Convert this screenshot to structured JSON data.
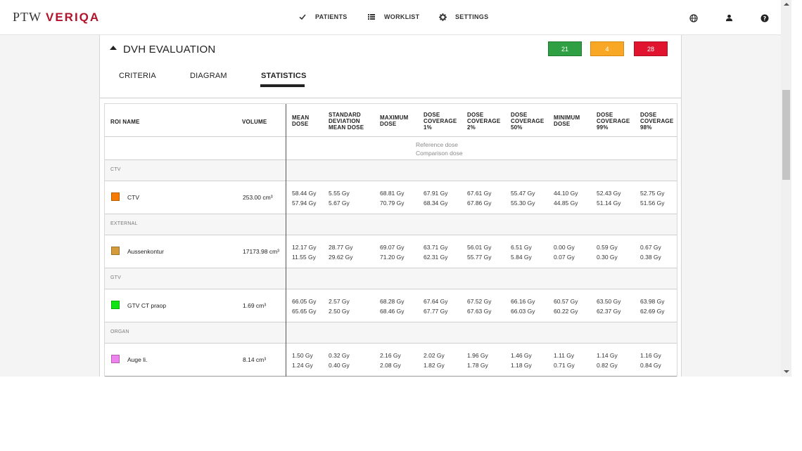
{
  "app": {
    "logo_left": "PTW",
    "logo_right": "VERIQA"
  },
  "nav": {
    "patients": "PATIENTS",
    "worklist": "WORKLIST",
    "settings": "SETTINGS"
  },
  "icons": {
    "patients": "check-icon",
    "worklist": "list-icon",
    "settings": "gear-icon",
    "right": [
      "globe-icon",
      "user-icon",
      "help-icon"
    ]
  },
  "panel": {
    "title": "DVH EVALUATION",
    "badges": {
      "green": "21",
      "orange": "4",
      "red": "28"
    },
    "colors": {
      "green": "#2ea043",
      "orange": "#f9a825",
      "red": "#e0142e"
    },
    "tabs": [
      "CRITERIA",
      "DIAGRAM",
      "STATISTICS"
    ],
    "active_tab": "STATISTICS"
  },
  "table": {
    "headers": {
      "roi_name": "ROI NAME",
      "volume": "VOLUME",
      "cols": [
        [
          "MEAN",
          "DOSE"
        ],
        [
          "STANDARD",
          "DEVIATION",
          "MEAN DOSE"
        ],
        [
          "MAXIMUM",
          "DOSE"
        ],
        [
          "DOSE",
          "COVERAGE",
          "1%"
        ],
        [
          "DOSE",
          "COVERAGE",
          "2%"
        ],
        [
          "DOSE",
          "COVERAGE",
          "50%"
        ],
        [
          "MINIMUM",
          "DOSE"
        ],
        [
          "DOSE",
          "COVERAGE",
          "99%"
        ],
        [
          "DOSE",
          "COVERAGE",
          "98%"
        ]
      ]
    },
    "legend": {
      "reference": "Reference dose",
      "comparison": "Comparison dose"
    },
    "groups": [
      {
        "label": "CTV",
        "roi": {
          "name": "CTV",
          "color": "#f57c00",
          "volume": "253.00 cm³",
          "values": [
            [
              "58.44 Gy",
              "57.94 Gy"
            ],
            [
              "5.55 Gy",
              "5.67 Gy"
            ],
            [
              "68.81 Gy",
              "70.79 Gy"
            ],
            [
              "67.91 Gy",
              "68.34 Gy"
            ],
            [
              "67.61 Gy",
              "67.86 Gy"
            ],
            [
              "55.47 Gy",
              "55.30 Gy"
            ],
            [
              "44.10 Gy",
              "44.85 Gy"
            ],
            [
              "52.43 Gy",
              "51.14 Gy"
            ],
            [
              "52.75 Gy",
              "51.56 Gy"
            ]
          ]
        }
      },
      {
        "label": "EXTERNAL",
        "roi": {
          "name": "Aussenkontur",
          "color": "#d59b3b",
          "volume": "17173.98 cm³",
          "values": [
            [
              "12.17 Gy",
              "11.55 Gy"
            ],
            [
              "28.77 Gy",
              "29.62 Gy"
            ],
            [
              "69.07 Gy",
              "71.20 Gy"
            ],
            [
              "63.71 Gy",
              "62.31 Gy"
            ],
            [
              "56.01 Gy",
              "55.77 Gy"
            ],
            [
              "6.51 Gy",
              "5.84 Gy"
            ],
            [
              "0.00 Gy",
              "0.07 Gy"
            ],
            [
              "0.59 Gy",
              "0.30 Gy"
            ],
            [
              "0.67 Gy",
              "0.38 Gy"
            ]
          ]
        }
      },
      {
        "label": "GTV",
        "roi": {
          "name": "GTV CT praop",
          "color": "#11e511",
          "volume": "1.69 cm³",
          "values": [
            [
              "66.05 Gy",
              "65.65 Gy"
            ],
            [
              "2.57 Gy",
              "2.50 Gy"
            ],
            [
              "68.28 Gy",
              "68.46 Gy"
            ],
            [
              "67.64 Gy",
              "67.77 Gy"
            ],
            [
              "67.52 Gy",
              "67.63 Gy"
            ],
            [
              "66.16 Gy",
              "66.03 Gy"
            ],
            [
              "60.57 Gy",
              "60.22 Gy"
            ],
            [
              "63.50 Gy",
              "62.37 Gy"
            ],
            [
              "63.98 Gy",
              "62.69 Gy"
            ]
          ]
        }
      },
      {
        "label": "ORGAN",
        "roi": {
          "name": "Auge li.",
          "color": "#ee82ee",
          "volume": "8.14 cm³",
          "values": [
            [
              "1.50 Gy",
              "1.24 Gy"
            ],
            [
              "0.32 Gy",
              "0.40 Gy"
            ],
            [
              "2.16 Gy",
              "2.08 Gy"
            ],
            [
              "2.02 Gy",
              "1.82 Gy"
            ],
            [
              "1.96 Gy",
              "1.78 Gy"
            ],
            [
              "1.46 Gy",
              "1.18 Gy"
            ],
            [
              "1.11 Gy",
              "0.71 Gy"
            ],
            [
              "1.14 Gy",
              "0.82 Gy"
            ],
            [
              "1.16 Gy",
              "0.84 Gy"
            ]
          ]
        }
      }
    ]
  }
}
